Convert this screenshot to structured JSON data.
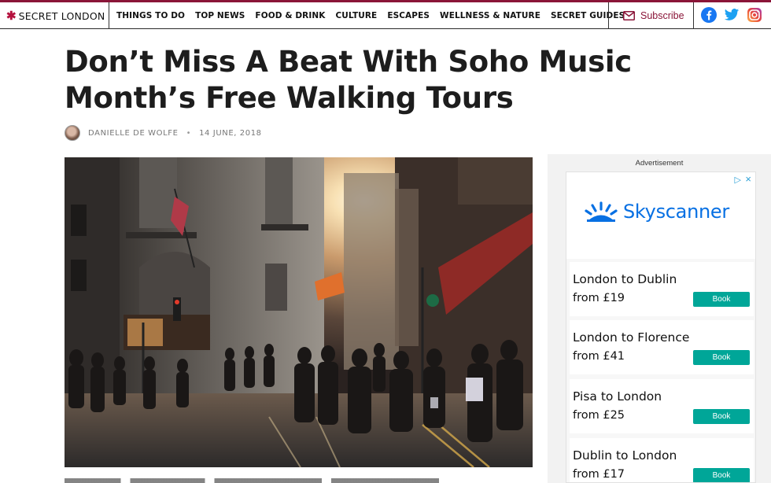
{
  "colors": {
    "brand": "#8a1538",
    "skyscanner_blue": "#0770e3",
    "book_teal": "#00a698",
    "facebook": "#1877f2",
    "twitter": "#1da1f2"
  },
  "header": {
    "logo_text": "SECRET LONDON",
    "logo_icon": "asterisk-star-icon",
    "nav_items": [
      "THINGS TO DO",
      "TOP NEWS",
      "FOOD & DRINK",
      "CULTURE",
      "ESCAPES",
      "WELLNESS & NATURE",
      "SECRET GUIDES"
    ],
    "subscribe_label": "Subscribe",
    "subscribe_icon": "envelope-icon",
    "social_icons": [
      "facebook-icon",
      "twitter-icon",
      "instagram-icon"
    ]
  },
  "article": {
    "title": "Don’t Miss A Beat With Soho Music Month’s Free Walking Tours",
    "author": "DANIELLE DE WOLFE",
    "separator": "•",
    "date": "14 JUNE, 2018",
    "hero_alt": "Crowded London street at sunset"
  },
  "ad": {
    "label": "Advertisement",
    "brand": "Skyscanner",
    "info_icon": "ad-choices-icon",
    "close_icon": "close-icon",
    "deals": [
      {
        "route": "London to Dublin",
        "price": "from £19",
        "cta": "Book"
      },
      {
        "route": "London to Florence",
        "price": "from £41",
        "cta": "Book"
      },
      {
        "route": "Pisa to London",
        "price": "from £25",
        "cta": "Book"
      },
      {
        "route": "Dublin to London",
        "price": "from £17",
        "cta": "Book"
      }
    ]
  }
}
